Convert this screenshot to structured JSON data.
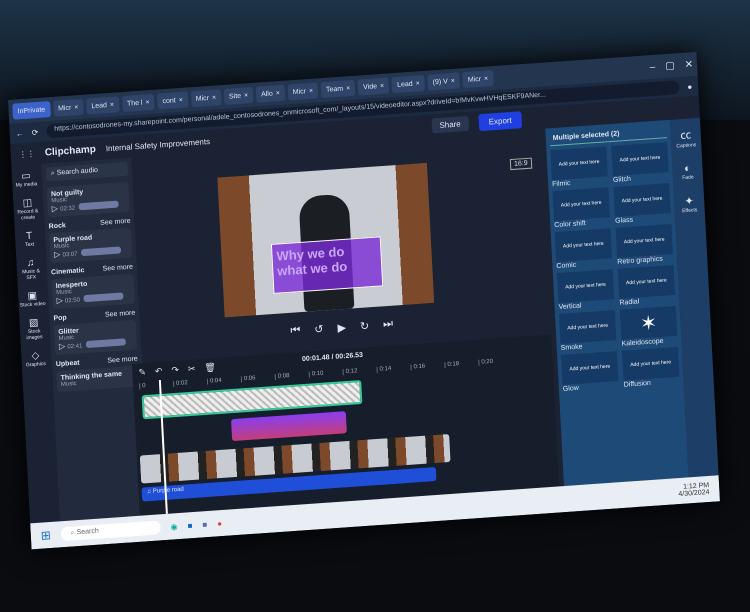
{
  "browser": {
    "tabs": [
      "InPrivate",
      "Micr",
      "Lead",
      "The l",
      "cont",
      "Micr",
      "Site",
      "Allo",
      "Micr",
      "Team",
      "Vide",
      "Lead",
      "(9) V",
      "Micr"
    ],
    "url": "https://contosodrones-my.sharepoint.com/personal/adele_contosodrones_onmicrosoft_com/_layouts/15/videoeditor.aspx?driveId=b!MvKvwHVHqESKF9ANer..."
  },
  "app": {
    "name": "Clipchamp",
    "project": "Internal Safety Improvements",
    "share": "Share",
    "export": "Export",
    "ratio": "16:9"
  },
  "rail": [
    {
      "icon": "folder",
      "label": "My media"
    },
    {
      "icon": "camera",
      "label": "Record & create"
    },
    {
      "icon": "T",
      "label": "Text"
    },
    {
      "icon": "music",
      "label": "Music & SFX"
    },
    {
      "icon": "video",
      "label": "Stock video"
    },
    {
      "icon": "image",
      "label": "Stock images"
    },
    {
      "icon": "shapes",
      "label": "Graphics"
    }
  ],
  "audio": {
    "search": "Search audio",
    "sections": [
      {
        "name": "",
        "see": "",
        "tracks": [
          {
            "title": "Not guilty",
            "type": "Music",
            "dur": "02:32"
          }
        ]
      },
      {
        "name": "Rock",
        "see": "See more",
        "tracks": [
          {
            "title": "Purple road",
            "type": "Music",
            "dur": "03:07"
          }
        ]
      },
      {
        "name": "Cinematic",
        "see": "See more",
        "tracks": [
          {
            "title": "Inesperto",
            "type": "Music",
            "dur": "02:50"
          }
        ]
      },
      {
        "name": "Pop",
        "see": "See more",
        "tracks": [
          {
            "title": "Glitter",
            "type": "Music",
            "dur": "02:41"
          }
        ]
      },
      {
        "name": "Upbeat",
        "see": "See more",
        "tracks": [
          {
            "title": "Thinking the same",
            "type": "Music",
            "dur": ""
          }
        ]
      }
    ]
  },
  "preview": {
    "overlay_text": "Why we do what we do"
  },
  "timeline": {
    "current": "00:01.48",
    "total": "00:26.53",
    "ticks": [
      "0",
      "0:02",
      "0:04",
      "0:06",
      "0:08",
      "0:10",
      "0:12",
      "0:14",
      "0:16",
      "0:18",
      "0:20"
    ],
    "audio_clip": "Purple road"
  },
  "effects": {
    "header": "Multiple selected (2)",
    "thumb_text": "Add your text here",
    "items": [
      "Filmic",
      "Glitch",
      "Color shift",
      "Glass",
      "Comic",
      "Retro graphics",
      "Vertical",
      "Radial",
      "Smoke",
      "Kaleidoscope",
      "Glow",
      "Diffusion"
    ]
  },
  "properties": [
    "Captions",
    "Fade",
    "Effects"
  ],
  "taskbar": {
    "search": "Search",
    "time": "1:12 PM",
    "date": "4/30/2024"
  }
}
